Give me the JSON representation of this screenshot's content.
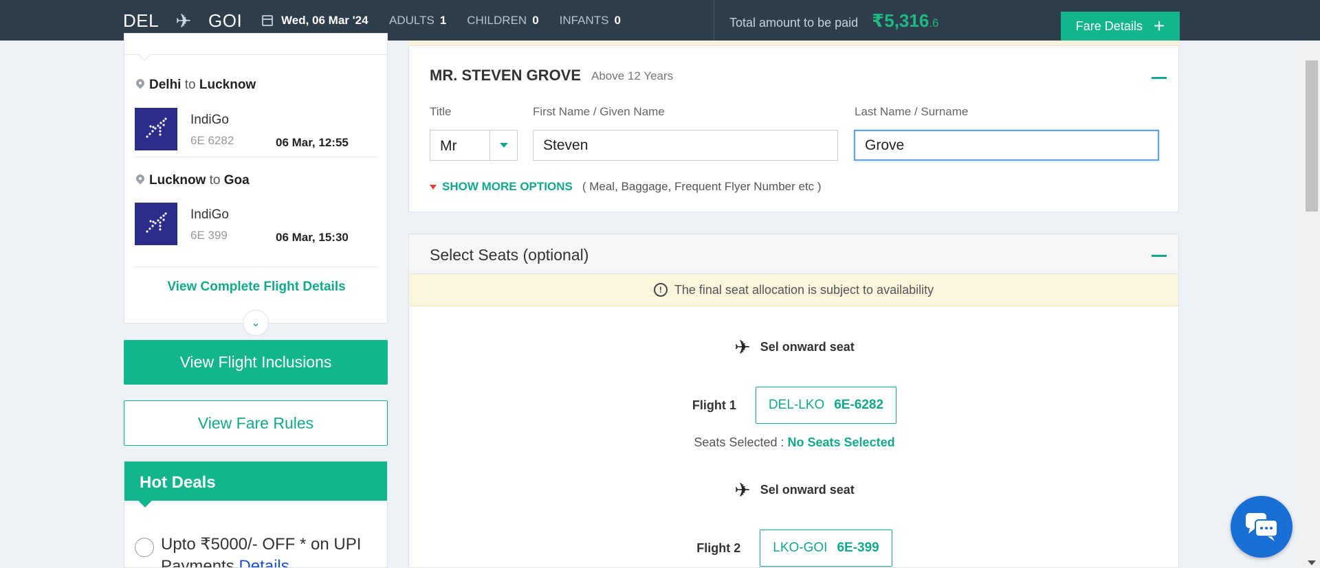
{
  "header": {
    "from": "DEL",
    "to": "GOI",
    "date": "Wed, 06 Mar '24",
    "adults_label": "ADULTS",
    "adults": "1",
    "children_label": "CHILDREN",
    "children": "0",
    "infants_label": "INFANTS",
    "infants": "0",
    "total_label": "Total amount to be paid",
    "currency": "₹",
    "total_main": "5,316",
    "total_decimal": ".6",
    "fare_button": "Fare Details"
  },
  "sidebar": {
    "legs": [
      {
        "from": "Delhi",
        "to_word": "to",
        "to": "Lucknow",
        "airline": "IndiGo",
        "code": "6E 6282",
        "time": "06 Mar, 12:55"
      },
      {
        "from": "Lucknow",
        "to_word": "to",
        "to": "Goa",
        "airline": "IndiGo",
        "code": "6E 399",
        "time": "06 Mar, 15:30"
      }
    ],
    "view_complete": "View Complete Flight Details",
    "inclusions_button": "View Flight Inclusions",
    "fare_rules_button": "View Fare Rules",
    "hot_deals": {
      "title": "Hot Deals",
      "item_text": "Upto ₹5000/- OFF * on UPI Payments",
      "item_link": "Details"
    }
  },
  "traveller": {
    "name": "MR. STEVEN GROVE",
    "age": "Above 12 Years",
    "title_label": "Title",
    "title_value": "Mr",
    "first_label": "First Name / Given Name",
    "first_value": "Steven",
    "last_label": "Last Name / Surname",
    "last_value": "Grove",
    "more_options": "SHOW MORE OPTIONS",
    "more_hint": "( Meal, Baggage, Frequent Flyer Number etc )"
  },
  "seats": {
    "title": "Select Seats (optional)",
    "note": "The final seat allocation is subject to availability",
    "onward_label": "Sel onward seat",
    "flights": [
      {
        "label": "Flight 1",
        "route": "DEL-LKO",
        "code": "6E-6282"
      },
      {
        "label": "Flight 2",
        "route": "LKO-GOI",
        "code": "6E-399"
      }
    ],
    "selected_label": "Seats Selected :",
    "selected_value": "No Seats Selected"
  },
  "colors": {
    "accent": "#13b58c",
    "header_bg": "#2e3d4b",
    "chat": "#1a6fd6"
  }
}
